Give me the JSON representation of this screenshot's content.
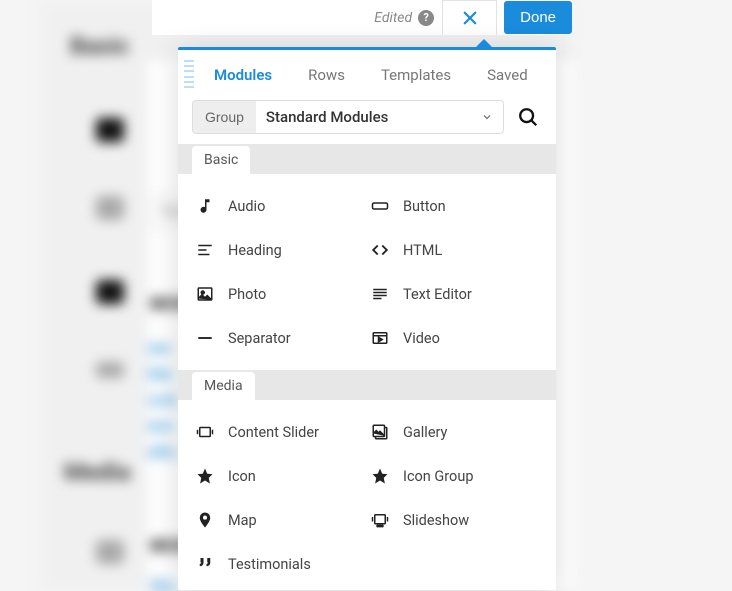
{
  "toolbar": {
    "edited_label": "Edited",
    "done_label": "Done"
  },
  "panel": {
    "tabs": [
      "Modules",
      "Rows",
      "Templates",
      "Saved"
    ],
    "active_tab": 0,
    "group_label": "Group",
    "dropdown_value": "Standard Modules",
    "sections": [
      {
        "title": "Basic",
        "items": [
          {
            "icon": "audio",
            "label": "Audio"
          },
          {
            "icon": "button",
            "label": "Button"
          },
          {
            "icon": "heading",
            "label": "Heading"
          },
          {
            "icon": "html",
            "label": "HTML"
          },
          {
            "icon": "photo",
            "label": "Photo"
          },
          {
            "icon": "texteditor",
            "label": "Text Editor"
          },
          {
            "icon": "separator",
            "label": "Separator"
          },
          {
            "icon": "video",
            "label": "Video"
          }
        ]
      },
      {
        "title": "Media",
        "items": [
          {
            "icon": "contentslider",
            "label": "Content Slider"
          },
          {
            "icon": "gallery",
            "label": "Gallery"
          },
          {
            "icon": "icon",
            "label": "Icon"
          },
          {
            "icon": "icongroup",
            "label": "Icon Group"
          },
          {
            "icon": "map",
            "label": "Map"
          },
          {
            "icon": "slideshow",
            "label": "Slideshow"
          },
          {
            "icon": "testimonials",
            "label": "Testimonials"
          }
        ]
      }
    ]
  },
  "background": {
    "left_heading_1": "Basic",
    "left_heading_2": "Media",
    "search_placeholder": "Sea",
    "eco_1": "eco",
    "eco_2": "eco",
    "links": [
      "ew",
      "ble",
      "ock",
      "ere",
      "ello"
    ],
    "wo": "Wo"
  }
}
